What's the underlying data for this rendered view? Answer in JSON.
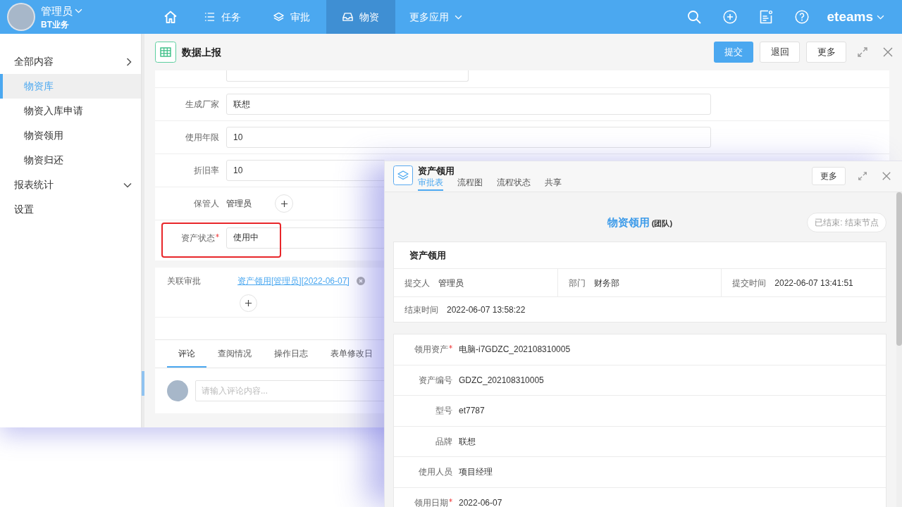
{
  "top_bar": {
    "user": {
      "name": "管理员",
      "org": "BT业务"
    },
    "nav": [
      {
        "kind": "home",
        "selected": false
      },
      {
        "kind": "tasks",
        "label": "任务",
        "selected": false
      },
      {
        "kind": "approvals",
        "label": "审批",
        "selected": false
      },
      {
        "kind": "assets",
        "label": "物资",
        "selected": true
      },
      {
        "kind": "more",
        "label": "更多应用",
        "selected": false
      }
    ],
    "brand": "eteams"
  },
  "sidebar": {
    "items": [
      {
        "label": "全部内容",
        "expanded": true,
        "selected": false,
        "children": [
          {
            "label": "物资库",
            "selected": true
          },
          {
            "label": "物资入库申请",
            "selected": false
          },
          {
            "label": "物资领用",
            "selected": false
          },
          {
            "label": "物资归还",
            "selected": false
          }
        ]
      },
      {
        "label": "报表统计",
        "expanded": false,
        "selected": false
      },
      {
        "label": "设置",
        "selected": false
      }
    ]
  },
  "page": {
    "title": "数据上报",
    "buttons": [
      {
        "label": "提交",
        "kind": "primary"
      },
      {
        "label": "退回",
        "kind": "default"
      },
      {
        "label": "更多",
        "kind": "default"
      }
    ]
  },
  "form": {
    "rows": [
      {
        "kind": "clipped"
      },
      {
        "kind": "input",
        "label": "生成厂家",
        "value": "联想",
        "required": false,
        "highlighted": false
      },
      {
        "kind": "input",
        "label": "使用年限",
        "value": "10",
        "required": false,
        "highlighted": false
      },
      {
        "kind": "input",
        "label": "折旧率",
        "value": "10",
        "required": false,
        "highlighted": false
      },
      {
        "kind": "person",
        "label": "保管人",
        "value": "管理员",
        "required": false,
        "highlighted": false
      },
      {
        "kind": "input",
        "label": "资产状态",
        "value": "使用中",
        "required": true,
        "highlighted": true
      }
    ]
  },
  "related": {
    "label": "关联审批",
    "links": [
      "资产领用[管理员][2022-06-07]"
    ]
  },
  "activity": {
    "tabs": [
      {
        "label": "评论",
        "selected": true
      },
      {
        "label": "查阅情况",
        "selected": false
      },
      {
        "label": "操作日志",
        "selected": false
      },
      {
        "label": "表单修改日",
        "selected": false
      }
    ],
    "comment": {
      "placeholder": "请输入评论内容..."
    }
  },
  "dialog": {
    "title": "资产领用",
    "tabs": [
      {
        "label": "审批表",
        "selected": true
      },
      {
        "label": "流程图",
        "selected": false
      },
      {
        "label": "流程状态",
        "selected": false
      },
      {
        "label": "共享",
        "selected": false
      }
    ],
    "buttons": [
      {
        "label": "更多"
      }
    ],
    "heading": {
      "title": "物资领用",
      "suffix": "(团队)",
      "status": "已结束: 结束节点"
    },
    "summary": {
      "title": "资产领用",
      "rows": [
        [
          {
            "label": "提交人",
            "value": "管理员"
          },
          {
            "label": "部门",
            "value": "财务部"
          },
          {
            "label": "提交时间",
            "value": "2022-06-07 13:41:51"
          }
        ],
        [
          {
            "label": "结束时间",
            "value": "2022-06-07 13:58:22"
          }
        ]
      ]
    },
    "details": [
      {
        "label": "领用资产",
        "value": "电脑-i7GDZC_202108310005",
        "required": true
      },
      {
        "label": "资产编号",
        "value": "GDZC_202108310005",
        "required": false
      },
      {
        "label": "型号",
        "value": "et7787",
        "required": false
      },
      {
        "label": "品牌",
        "value": "联想",
        "required": false
      },
      {
        "label": "使用人员",
        "value": "项目经理",
        "required": false
      },
      {
        "label": "领用日期",
        "value": "2022-06-07",
        "required": true
      }
    ]
  }
}
